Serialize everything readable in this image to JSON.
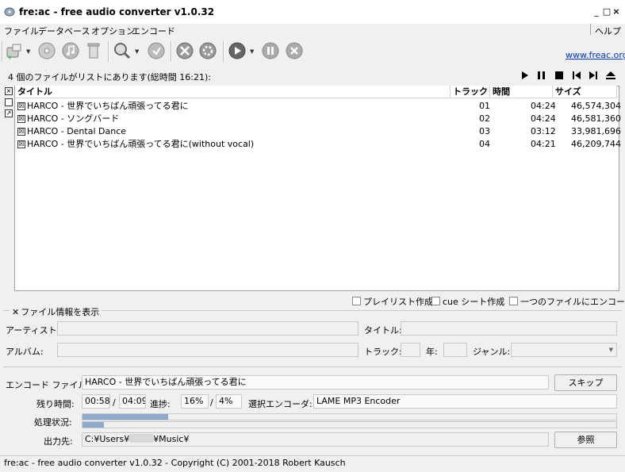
{
  "window": {
    "title": "fre:ac - free audio converter v1.0.32",
    "controls": {
      "minimize": "_",
      "maximize": "□",
      "close": "×"
    }
  },
  "menu": {
    "items": [
      "ファイル",
      "データベース",
      "オプション",
      "エンコード"
    ],
    "help": "ヘルプ"
  },
  "toolbar": {
    "icons": [
      "add-files-icon",
      "cd-rip-icon",
      "music-icon",
      "recycle-icon",
      "search-cd-icon",
      "cddb-icon",
      "tools-icon",
      "settings-icon",
      "play-encode-icon",
      "pause-icon",
      "stop-icon"
    ],
    "weblink": "www.freac.org"
  },
  "list": {
    "status": "4 個のファイルがリストにあります(総時間 16:21):",
    "columns": {
      "title": "タイトル",
      "track": "トラック",
      "time": "時間",
      "size": "サイズ"
    },
    "rows": [
      {
        "checked": "☒",
        "title": "HARCO - 世界でいちばん頑張ってる君に",
        "track": "01",
        "time": "04:24",
        "size": "46,574,304"
      },
      {
        "checked": "☒",
        "title": "HARCO - ソングバード",
        "track": "02",
        "time": "04:24",
        "size": "46,581,360"
      },
      {
        "checked": "☒",
        "title": "HARCO - Dental Dance",
        "track": "03",
        "time": "03:12",
        "size": "33,981,696"
      },
      {
        "checked": "☒",
        "title": "HARCO - 世界でいちばん頑張ってる君に(without vocal)",
        "track": "04",
        "time": "04:21",
        "size": "46,209,744"
      }
    ]
  },
  "options": {
    "playlist": "プレイリスト作成",
    "cue": "cue シート作成",
    "single_file": "一つのファイルにエンコード"
  },
  "file_info": {
    "toggle": "ファイル情報を表示",
    "artist_label": "アーティスト:",
    "title_label": "タイトル:",
    "album_label": "アルバム:",
    "track_label": "トラック:",
    "year_label": "年:",
    "genre_label": "ジャンル:"
  },
  "encode": {
    "file_label": "エンコード ファイル:",
    "file_value": "HARCO - 世界でいちばん頑張ってる君に",
    "skip_button": "スキップ",
    "remaining_label": "残り時間:",
    "elapsed": "00:58",
    "slash1": "/",
    "total": "04:09",
    "progress_label": "進捗:",
    "progress_file": "16%",
    "slash2": "/",
    "progress_total": "4%",
    "encoder_label": "選択エンコーダ:",
    "encoder_value": "LAME MP3 Encoder",
    "status_label": "処理状況:",
    "file_progress": 0.16,
    "total_progress": 0.04,
    "output_label": "出力先:",
    "output_prefix": "C:¥Users¥",
    "output_suffix": "¥Music¥",
    "browse_button": "参照"
  },
  "statusbar": {
    "text": "fre:ac - free audio converter v1.0.32 - Copyright (C) 2001-2018 Robert Kausch"
  },
  "colors": {
    "progress": "#8fa9cc",
    "link": "#0033cc"
  }
}
